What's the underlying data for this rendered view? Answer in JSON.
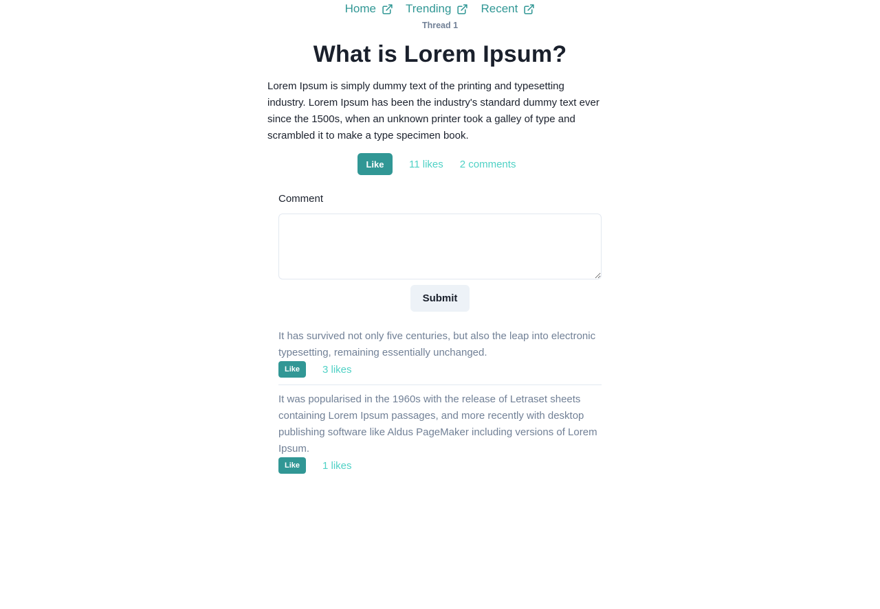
{
  "nav": {
    "items": [
      {
        "label": "Home",
        "icon": "external-link-icon"
      },
      {
        "label": "Trending",
        "icon": "external-link-icon"
      },
      {
        "label": "Recent",
        "icon": "external-link-icon"
      }
    ]
  },
  "thread": {
    "label": "Thread 1",
    "title": "What is Lorem Ipsum?",
    "body": "Lorem Ipsum is simply dummy text of the printing and typesetting industry. Lorem Ipsum has been the industry's standard dummy text ever since the 1500s, when an unknown printer took a galley of type and scrambled it to make a type specimen book.",
    "like_label": "Like",
    "likes_text": "11 likes",
    "comments_text": "2 comments"
  },
  "comment_form": {
    "label": "Comment",
    "value": "",
    "submit_label": "Submit"
  },
  "comments": [
    {
      "text": "It has survived not only five centuries, but also the leap into electronic typesetting, remaining essentially unchanged.",
      "like_label": "Like",
      "likes_text": "3 likes"
    },
    {
      "text": "It was popularised in the 1960s with the release of Letraset sheets containing Lorem Ipsum passages, and more recently with desktop publishing software like Aldus PageMaker including versions of Lorem Ipsum.",
      "like_label": "Like",
      "likes_text": "1 likes"
    }
  ],
  "colors": {
    "accent": "#319795",
    "accent_light": "#4fd1c5",
    "muted_text": "#718096",
    "heading": "#1a202c",
    "border": "#e2e8f0",
    "button_gray": "#edf2f7"
  }
}
